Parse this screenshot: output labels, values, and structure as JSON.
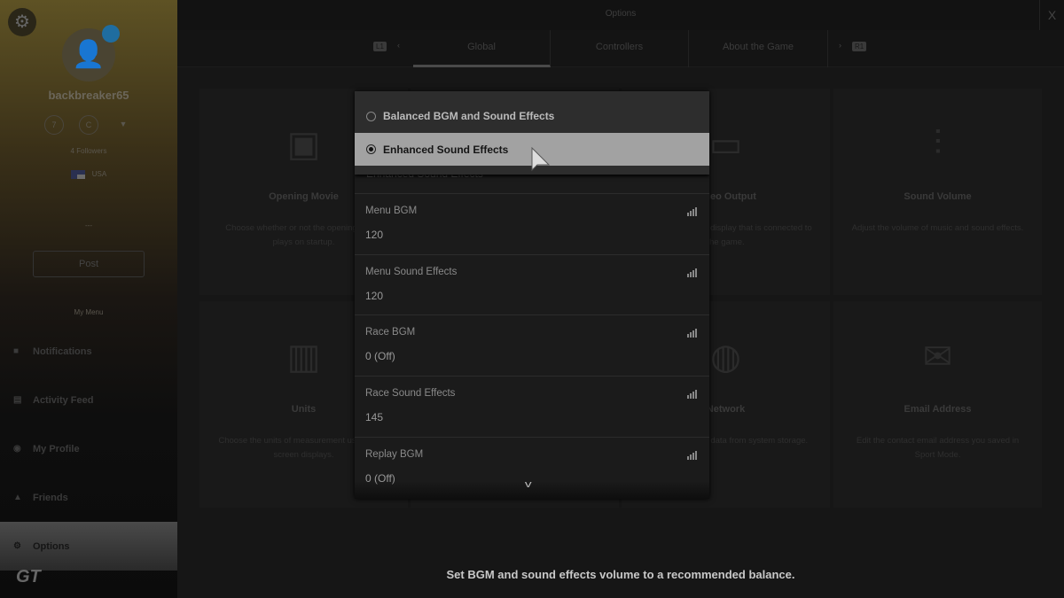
{
  "sidebar": {
    "username": "backbreaker65",
    "stats": [
      "7",
      "C",
      ""
    ],
    "followers": "4  Followers",
    "country": "USA",
    "separator": "---",
    "post_label": "Post",
    "menu_heading": "My Menu",
    "items": [
      {
        "label": "Notifications",
        "icon": "bell-icon"
      },
      {
        "label": "Activity Feed",
        "icon": "feed-icon"
      },
      {
        "label": "My Profile",
        "icon": "profile-icon"
      },
      {
        "label": "Friends",
        "icon": "friends-icon"
      },
      {
        "label": "Options",
        "icon": "gear-icon",
        "active": true
      }
    ],
    "logo": "GT"
  },
  "header": {
    "title": "Options",
    "close": "X"
  },
  "tabs": {
    "left_button": "L1",
    "right_button": "R1",
    "items": [
      {
        "label": "Global",
        "active": true
      },
      {
        "label": "Controllers"
      },
      {
        "label": "About the Game"
      }
    ]
  },
  "cards": [
    {
      "title": "Opening Movie",
      "desc": "Choose whether or not the opening movie plays on startup.",
      "icon": "film-icon"
    },
    {
      "title": "",
      "desc": "",
      "icon": ""
    },
    {
      "title": "Video Output",
      "desc": "Set options for the display that is connected to the game.",
      "icon": "monitor-icon"
    },
    {
      "title": "Sound Volume",
      "desc": "Adjust the volume of music and sound effects.",
      "icon": "sliders-icon"
    },
    {
      "title": "Units",
      "desc": "Choose the units of measurement used in on-screen displays.",
      "icon": "ruler-icon"
    },
    {
      "title": "",
      "desc": "",
      "icon": ""
    },
    {
      "title": "Network",
      "desc": "Delete temporary data from system storage.",
      "icon": "globe-icon"
    },
    {
      "title": "Email Address",
      "desc": "Edit the contact email address you saved in Sport Mode.",
      "icon": "envelope-icon"
    }
  ],
  "dropdown": {
    "options": [
      {
        "label": "Balanced BGM and Sound Effects",
        "selected": false
      },
      {
        "label": "Enhanced Sound Effects",
        "selected": true
      }
    ],
    "current_value": "Enhanced Sound Effects",
    "rows": [
      {
        "label": "Menu BGM",
        "value": "120"
      },
      {
        "label": "Menu Sound Effects",
        "value": "120"
      },
      {
        "label": "Race BGM",
        "value": "0 (Off)"
      },
      {
        "label": "Race Sound Effects",
        "value": "145"
      },
      {
        "label": "Replay BGM",
        "value": "0 (Off)"
      }
    ]
  },
  "hint": "Set BGM and sound effects volume to a recommended balance."
}
